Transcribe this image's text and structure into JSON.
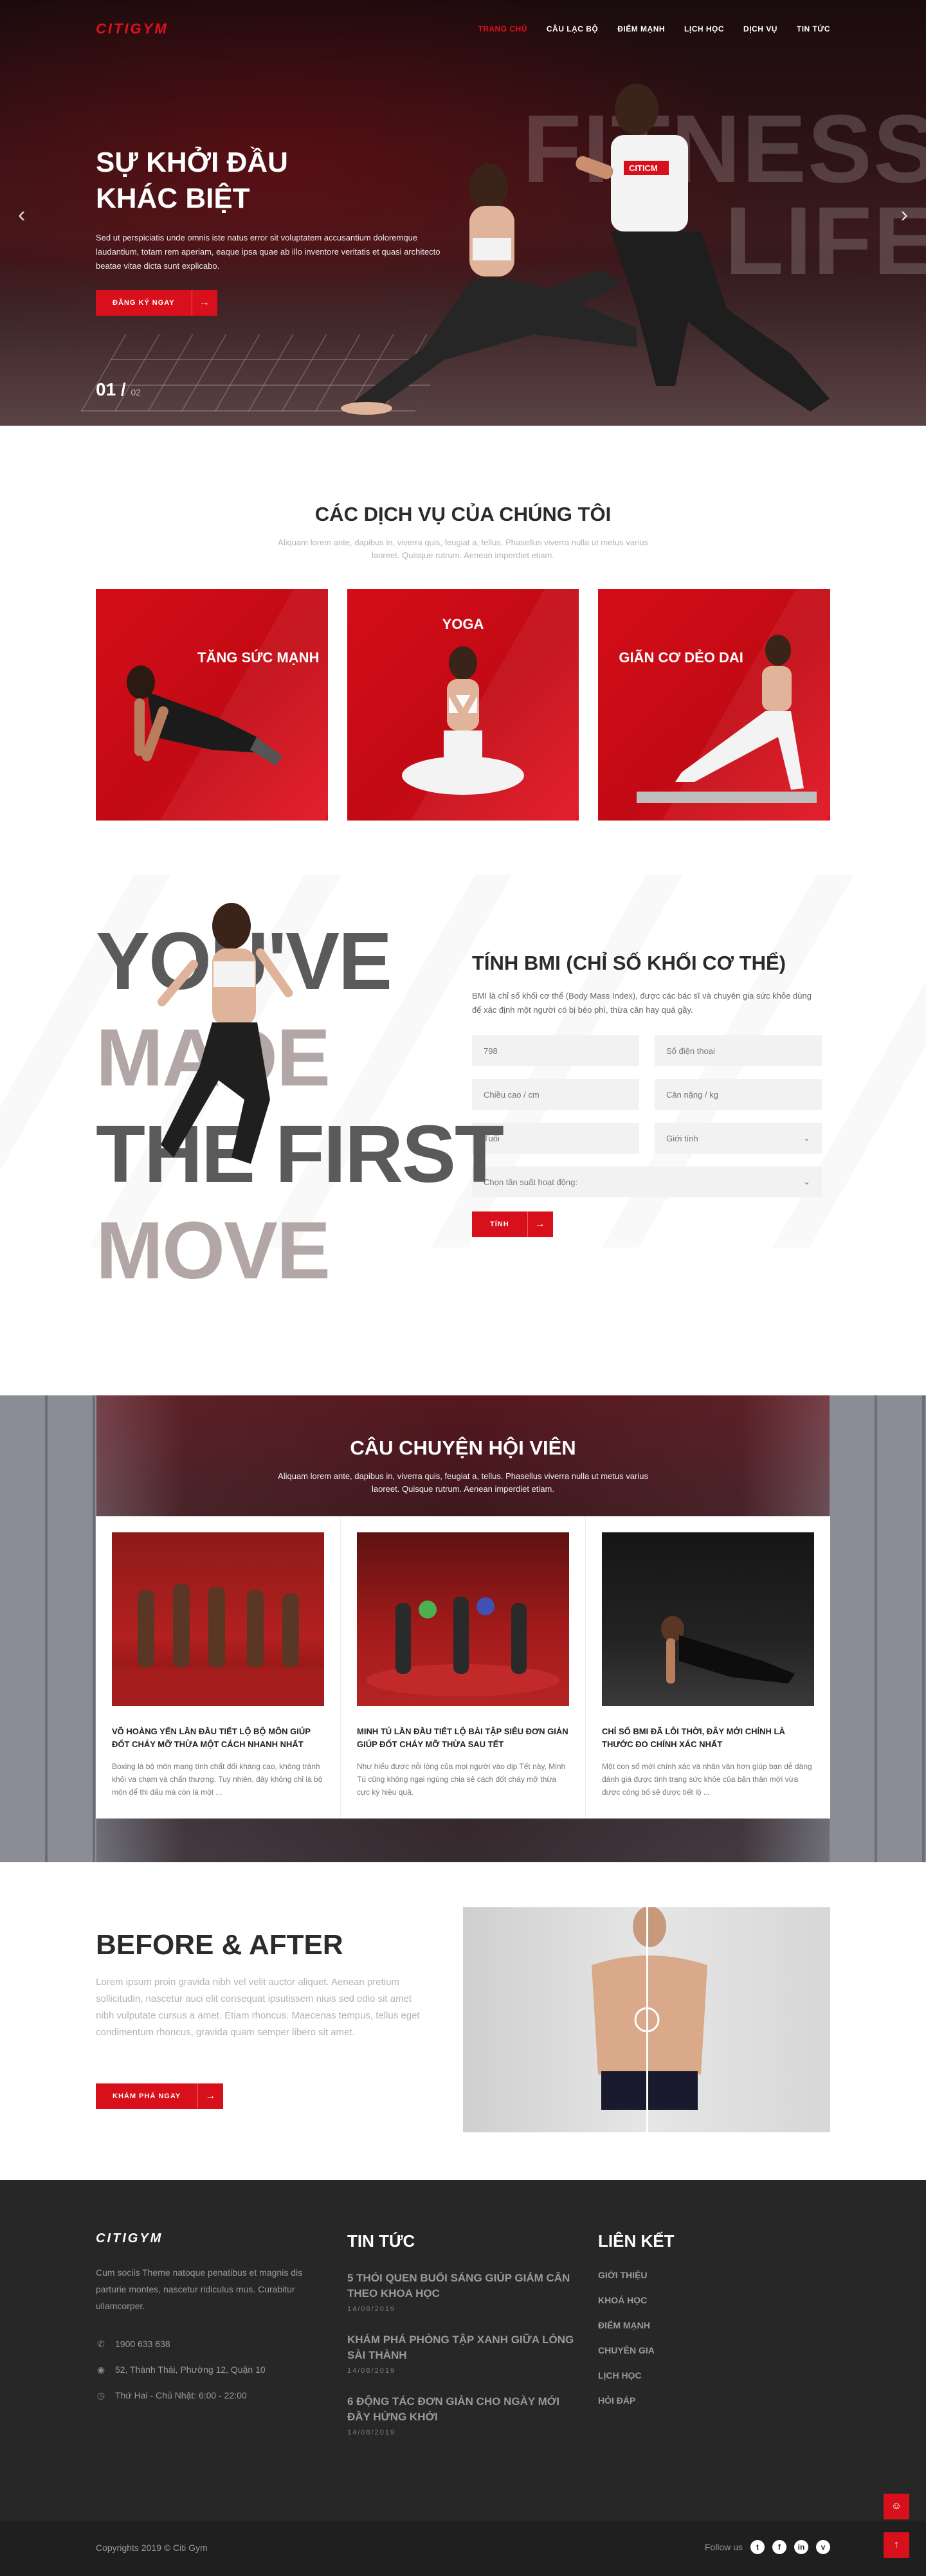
{
  "header": {
    "logo": "CITIGYM",
    "menu": [
      "Trang chủ",
      "Câu lạc bộ",
      "Điểm mạnh",
      "Lịch học",
      "Dịch vụ",
      "Tin tức"
    ]
  },
  "hero": {
    "title_line1": "Sự khởi đầu",
    "title_line2": "khác biệt",
    "text": "Sed ut perspiciatis unde omnis iste natus error sit voluptatem accusantium doloremque laudantium, totam rem aperiam, eaque ipsa quae ab illo inventore veritatis et quasi architecto beatae vitae dicta sunt explicabo.",
    "button": "Đăng ký ngay",
    "slide_current": "01",
    "slide_total": "02",
    "ghost_text": [
      "FITNESS",
      "LIFE"
    ],
    "shirt_label": "CITICM"
  },
  "services": {
    "title": "Các dịch vụ của chúng tôi",
    "subtitle": "Aliquam lorem ante, dapibus in, viverra quis, feugiat a, tellus. Phasellus viverra nulla ut metus varius laoreet. Quisque rutrum. Aenean imperdiet etiam.",
    "cards": [
      "Tăng sức mạnh",
      "Yoga",
      "Giãn cơ dẻo dai"
    ]
  },
  "bmi": {
    "bigtext": [
      "YOU'VE",
      "MADE",
      "THE FIRST",
      "MOVE"
    ],
    "title": "Tính BMI (chỉ số khối cơ thể)",
    "text": "BMI là chỉ số khối cơ thể (Body Mass Index), được các bác sĩ và chuyên gia sức khỏe dùng để xác định một người có bị béo phì, thừa cân hay quá gầy.",
    "fields": {
      "name": "798",
      "phone": "Số điện thoại",
      "height": "Chiều cao / cm",
      "weight": "Cân nặng / kg",
      "age": "Tuổi",
      "gender": "Giới tính",
      "activity": "Chọn tần suất hoạt động:"
    },
    "button": "Tính"
  },
  "stories": {
    "title": "Câu chuyện hội viên",
    "subtitle": "Aliquam lorem ante, dapibus in, viverra quis, feugiat a, tellus. Phasellus viverra nulla ut metus varius laoreet. Quisque rutrum. Aenean imperdiet etiam.",
    "items": [
      {
        "title": "Võ Hoàng Yến lần đầu tiết lộ bộ môn giúp đốt cháy mỡ thừa một cách nhanh nhất",
        "text": "Boxing là bộ môn mang tính chất đối kháng cao, không tránh khỏi va chạm và chấn thương. Tuy nhiên, đây không chỉ là bộ môn để thi đấu mà còn là một ..."
      },
      {
        "title": "Minh Tú lần đầu tiết lộ bài tập siêu đơn giản giúp đốt cháy mỡ thừa sau Tết",
        "text": "Như hiểu được nỗi lòng của mọi người vào dịp Tết này, Minh Tú cũng không ngại ngùng chia sẻ cách đốt cháy mỡ thừa cực kỳ hiệu quả."
      },
      {
        "title": "Chỉ số BMI đã lỗi thời, đây mới chính là thước đo chính xác nhất",
        "text": "Một con số mới chính xác và nhân văn hơn giúp bạn dễ dàng đánh giá được tình trạng sức khỏe của bản thân mới vừa được công bố sẽ được tiết lộ ..."
      }
    ]
  },
  "before_after": {
    "title": "Before & After",
    "text": "Lorem ipsum proin gravida nibh vel velit auctor aliquet. Aenean pretium sollicitudin, nascetur auci elit consequat ipsutissem niuis sed odio sit amet nibh vulputate cursus a amet. Etiam rhoncus. Maecenas tempus, tellus eget condimentum rhoncus, gravida quam semper libero sit amet.",
    "button": "Khám phá ngay"
  },
  "footer": {
    "logo": "CITIGYM",
    "about": "Cum sociis Theme natoque penatibus et magnis dis parturie montes, nascetur ridiculus mus. Curabitur ullamcorper.",
    "phone": "1900 633 638",
    "address": "52, Thành Thái, Phường 12, Quận 10",
    "hours": "Thứ Hai - Chủ Nhật: 6:00 - 22:00",
    "news_title": "Tin tức",
    "news": [
      {
        "title": "5 thói quen buổi sáng giúp giảm cân theo khoa học",
        "date": "14/08/2019"
      },
      {
        "title": "Khám phá phòng tập xanh giữa lòng Sài Thành",
        "date": "14/08/2019"
      },
      {
        "title": "6 động tác đơn giản cho ngày mới đầy hứng khởi",
        "date": "14/08/2019"
      }
    ],
    "links_title": "Liên kết",
    "links": [
      "Giới thiệu",
      "Khoá học",
      "Điểm mạnh",
      "Chuyên gia",
      "Lịch học",
      "Hỏi đáp"
    ],
    "copyright": "Copyrights 2019 © Citi Gym",
    "follow": "Follow us",
    "social": [
      "t",
      "f",
      "in",
      "v"
    ]
  },
  "colors": {
    "brand_red": "#d8101b",
    "dark": "#272727"
  }
}
